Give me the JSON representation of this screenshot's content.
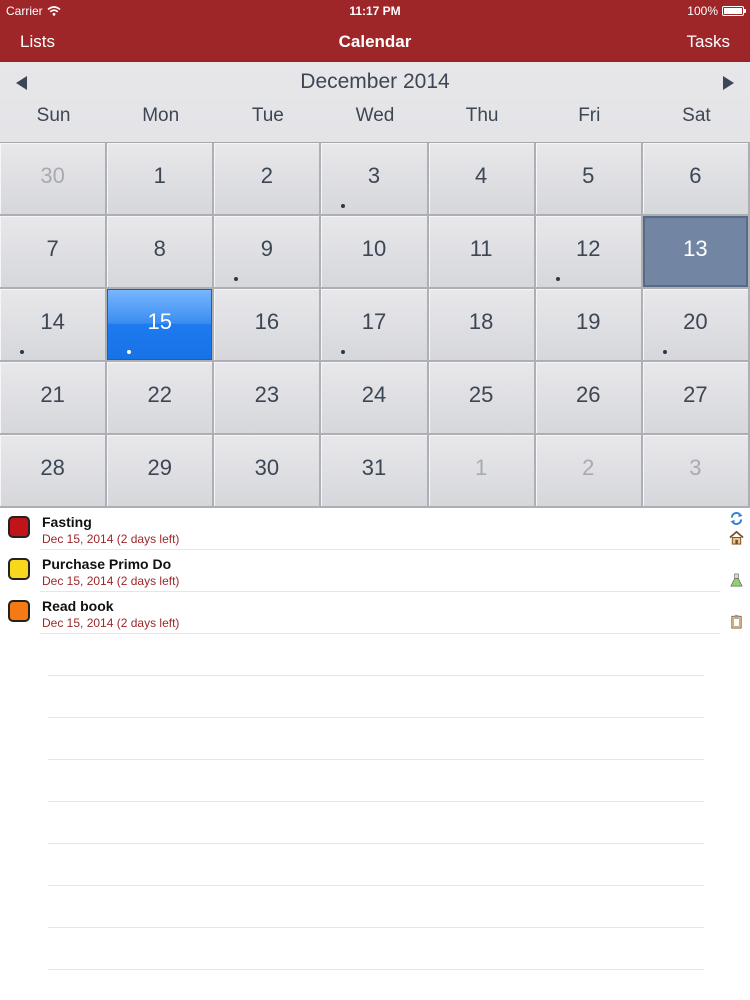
{
  "status_bar": {
    "carrier": "Carrier",
    "time": "11:17 PM",
    "battery": "100%"
  },
  "nav": {
    "left": "Lists",
    "title": "Calendar",
    "right": "Tasks"
  },
  "calendar": {
    "month_label": "December 2014",
    "weekdays": [
      "Sun",
      "Mon",
      "Tue",
      "Wed",
      "Thu",
      "Fri",
      "Sat"
    ],
    "weeks": [
      [
        {
          "d": "30",
          "out": true
        },
        {
          "d": "1"
        },
        {
          "d": "2"
        },
        {
          "d": "3",
          "dot": true
        },
        {
          "d": "4"
        },
        {
          "d": "5"
        },
        {
          "d": "6"
        }
      ],
      [
        {
          "d": "7"
        },
        {
          "d": "8"
        },
        {
          "d": "9",
          "dot": true
        },
        {
          "d": "10"
        },
        {
          "d": "11"
        },
        {
          "d": "12",
          "dot": true
        },
        {
          "d": "13",
          "today": true
        }
      ],
      [
        {
          "d": "14",
          "dot": true
        },
        {
          "d": "15",
          "selected": true,
          "dot": true
        },
        {
          "d": "16"
        },
        {
          "d": "17",
          "dot": true
        },
        {
          "d": "18"
        },
        {
          "d": "19"
        },
        {
          "d": "20",
          "dot": true
        }
      ],
      [
        {
          "d": "21"
        },
        {
          "d": "22"
        },
        {
          "d": "23"
        },
        {
          "d": "24"
        },
        {
          "d": "25"
        },
        {
          "d": "26"
        },
        {
          "d": "27"
        }
      ],
      [
        {
          "d": "28"
        },
        {
          "d": "29"
        },
        {
          "d": "30"
        },
        {
          "d": "31"
        },
        {
          "d": "1",
          "out": true
        },
        {
          "d": "2",
          "out": true
        },
        {
          "d": "3",
          "out": true
        }
      ]
    ]
  },
  "tasks": [
    {
      "name": "Fasting",
      "due": "Dec 15, 2014 (2 days left)",
      "color": "#c0141a"
    },
    {
      "name": "Purchase Primo Do",
      "due": "Dec 15, 2014 (2 days left)",
      "color": "#f9d71c"
    },
    {
      "name": "Read book",
      "due": "Dec 15, 2014 (2 days left)",
      "color": "#f57a14"
    }
  ],
  "side_icons": [
    "sync-icon",
    "home-icon",
    "flask-icon",
    "clipboard-icon"
  ],
  "colors": {
    "header": "#9e2629",
    "today": "#7286a3",
    "selected": "#1d7bef"
  }
}
